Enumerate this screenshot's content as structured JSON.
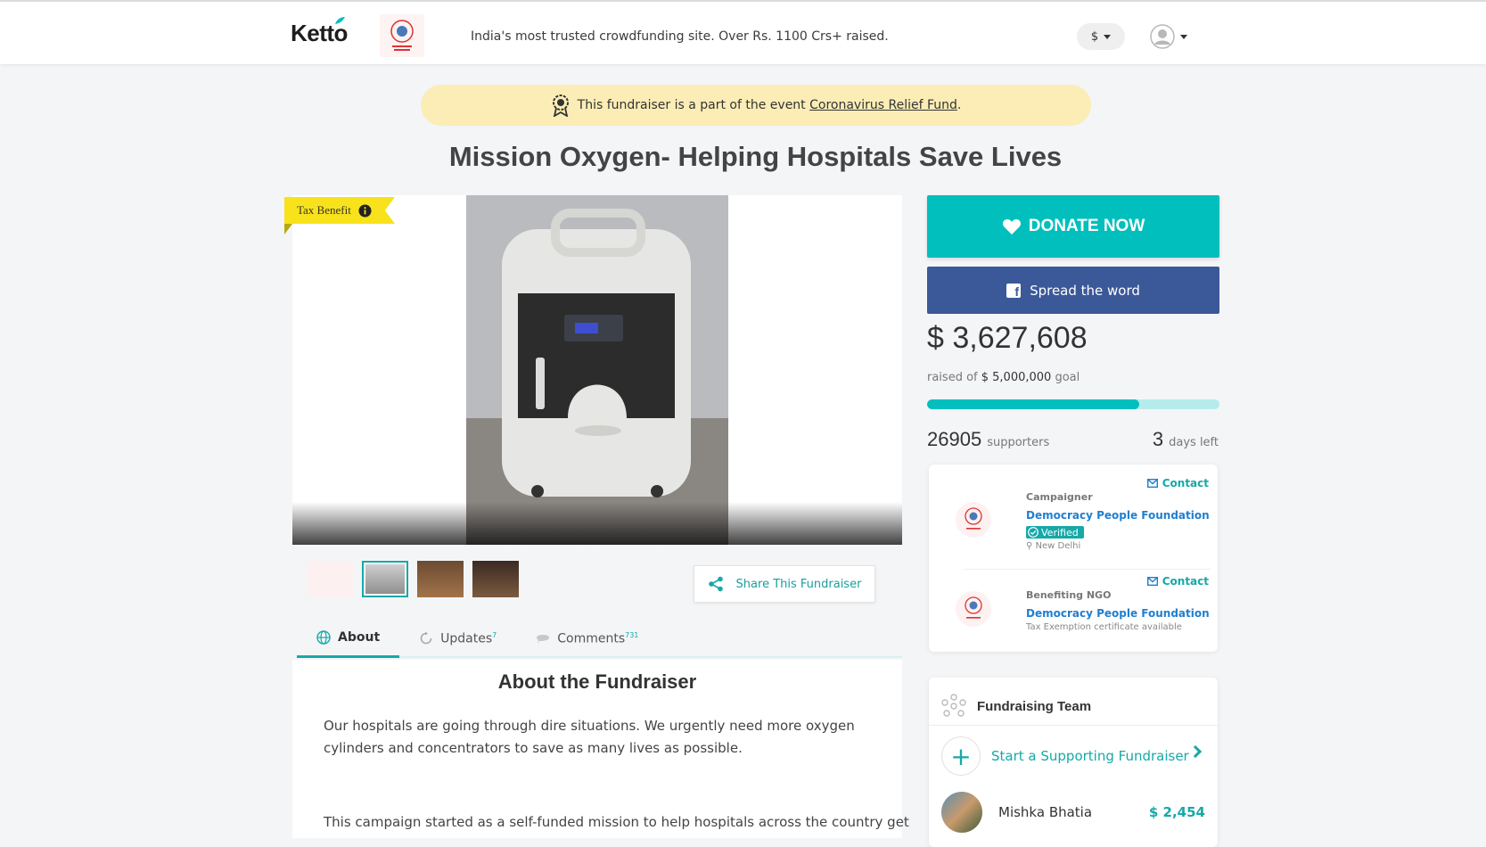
{
  "header": {
    "logo": "Ketto",
    "tagline": "India's most trusted crowdfunding site. Over Rs. 1100 Crs+ raised.",
    "currency": "$"
  },
  "event": {
    "prefix": "This fundraiser is a part of the event",
    "link": "Coronavirus Relief Fund",
    "suffix": "."
  },
  "title": "Mission Oxygen- Helping Hospitals Save Lives",
  "media": {
    "tax_badge": "Tax Benefit"
  },
  "share_label": "Share This Fundraiser",
  "tabs": [
    {
      "label": "About",
      "count": ""
    },
    {
      "label": "Updates",
      "count": "7"
    },
    {
      "label": "Comments",
      "count": "731"
    }
  ],
  "about": {
    "heading": "About the Fundraiser",
    "p1": "Our hospitals are going through dire situations. We urgently need more oxygen cylinders and concentrators to save as many lives as possible.",
    "p2": "This campaign started as a self-funded mission to help hospitals across the country get"
  },
  "donation": {
    "donate_label": "DONATE NOW",
    "spread_label": "Spread the word",
    "raised": "$ 3,627,608",
    "raised_prefix": "raised of",
    "goal": "$ 5,000,000",
    "goal_suffix": "goal",
    "progress_fraction": 0.725,
    "supporters_count": "26905",
    "supporters_label": "supporters",
    "days_count": "3",
    "days_label": "days left"
  },
  "contacts": {
    "contact_label": "Contact",
    "campaigner_role": "Campaigner",
    "campaigner_name": "Democracy People Foundation",
    "verified_label": "Verified",
    "location": "New Delhi",
    "ngo_role": "Benefiting NGO",
    "ngo_name": "Democracy People Foundation",
    "ngo_note": "Tax Exemption certificate available"
  },
  "team": {
    "heading": "Fundraising Team",
    "start_label": "Start a Supporting Fundraiser",
    "member_name": "Mishka Bhatia",
    "member_amount": "$ 2,454"
  },
  "colors": {
    "accent": "#01bfbd",
    "facebook": "#3b5998",
    "banner": "#fbedb5",
    "tax": "#f7e21b"
  }
}
